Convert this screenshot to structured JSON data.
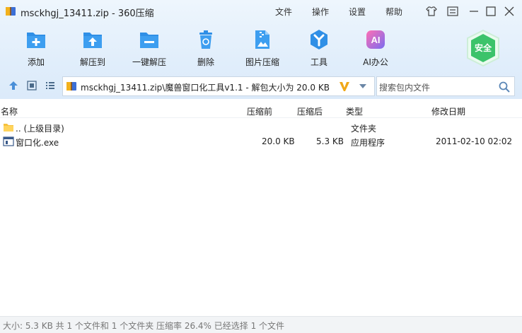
{
  "window": {
    "title": "msckhgj_13411.zip - 360压缩"
  },
  "menu": {
    "file": "文件",
    "operation": "操作",
    "settings": "设置",
    "help": "帮助"
  },
  "toolbar": {
    "add": "添加",
    "extract_to": "解压到",
    "one_click_extract": "一键解压",
    "delete": "删除",
    "image_compress": "图片压缩",
    "tools": "工具",
    "ai_office": "AI办公",
    "safe": "安全",
    "ai_icon_text": "AI"
  },
  "address": {
    "path": "msckhgj_13411.zip\\魔兽窗口化工具v1.1 - 解包大小为 20.0 KB"
  },
  "search": {
    "placeholder": "搜索包内文件"
  },
  "columns": {
    "name": "名称",
    "before": "压缩前",
    "after": "压缩后",
    "type": "类型",
    "modified": "修改日期"
  },
  "rows": [
    {
      "name": ".. (上级目录)",
      "before": "",
      "after": "",
      "type": "文件夹",
      "modified": "",
      "icon": "folder-icon"
    },
    {
      "name": "窗口化.exe",
      "before": "20.0 KB",
      "after": "5.3 KB",
      "type": "应用程序",
      "modified": "2011-02-10 02:02",
      "icon": "exe-icon"
    }
  ],
  "status": {
    "text": "大小: 5.3 KB 共 1 个文件和 1 个文件夹 压缩率 26.4% 已经选择 1 个文件"
  },
  "colors": {
    "toolbar_bg": "#e1eefb",
    "icon_blue": "#2f8fe6",
    "safe_green": "#3cc36a",
    "ai_pink": "#e84fa8"
  }
}
